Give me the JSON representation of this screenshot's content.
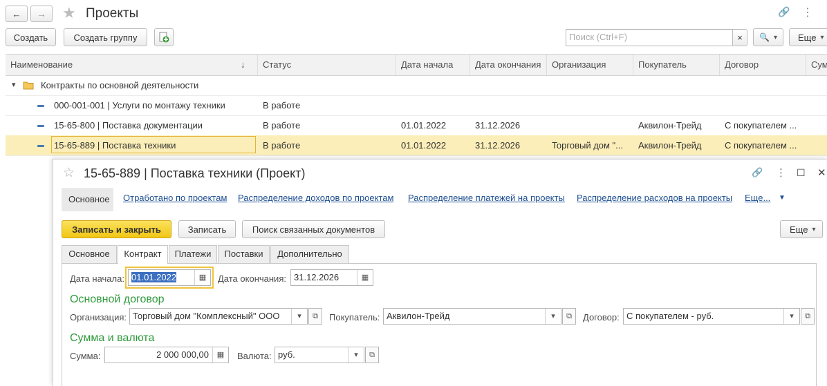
{
  "page": {
    "title": "Проекты",
    "back_icon": "←",
    "forward_icon": "→",
    "star_icon": "★",
    "link_icon": "🔗",
    "more_icon": "⋮"
  },
  "toolbar": {
    "create_label": "Создать",
    "create_group_label": "Создать группу",
    "search_placeholder": "Поиск (Ctrl+F)",
    "clear_icon": "×",
    "search_icon": "🔍",
    "more_label": "Еще"
  },
  "table": {
    "columns": [
      "Наименование",
      "Статус",
      "Дата начала",
      "Дата окончания",
      "Организация",
      "Покупатель",
      "Договор",
      "Сумма"
    ],
    "sort_icon": "↓",
    "group": {
      "expand_icon": "▾",
      "label": "Контракты по основной деятельности"
    },
    "rows": [
      {
        "name": "000-001-001 | Услуги по монтажу техники",
        "status": "В работе",
        "start": "",
        "end": "",
        "org": "",
        "buyer": "",
        "contract": ""
      },
      {
        "name": "15-65-800 | Поставка документации",
        "status": "В работе",
        "start": "01.01.2022",
        "end": "31.12.2026",
        "org": "",
        "buyer": "Аквилон-Трейд",
        "contract": "С покупателем ..."
      },
      {
        "name": "15-65-889 | Поставка техники",
        "status": "В работе",
        "start": "01.01.2022",
        "end": "31.12.2026",
        "org": "Торговый дом \"...",
        "buyer": "Аквилон-Трейд",
        "contract": "С покупателем ..."
      }
    ]
  },
  "dialog": {
    "title": "15-65-889 | Поставка техники (Проект)",
    "star_icon": "☆",
    "link_icon": "🔗",
    "more_icon": "⋮",
    "maximize_icon": "☐",
    "close_icon": "✕",
    "nav": {
      "main_label": "Основное",
      "links": [
        "Отработано по проектам",
        "Распределение доходов по проектам",
        "Распределение платежей на проекты",
        "Распределение расходов на проекты"
      ],
      "more_label": "Еще..."
    },
    "commands": {
      "save_close_label": "Записать и закрыть",
      "save_label": "Записать",
      "find_docs_label": "Поиск связанных документов",
      "more_label": "Еще"
    },
    "tabs": [
      "Основное",
      "Контракт",
      "Платежи",
      "Поставки",
      "Дополнительно"
    ],
    "form": {
      "start_label": "Дата начала:",
      "start_value": "01.01.2022",
      "end_label": "Дата окончания:",
      "end_value": "31.12.2026",
      "calendar_icon": "▦",
      "section_contract": "Основной договор",
      "org_label": "Организация:",
      "org_value": "Торговый дом \"Комплексный\" ООО",
      "buyer_label": "Покупатель:",
      "buyer_value": "Аквилон-Трейд",
      "contract_label": "Договор:",
      "contract_value": "С покупателем - руб.",
      "section_sum": "Сумма и валюта",
      "sum_label": "Сумма:",
      "sum_value": "2 000 000,00",
      "currency_label": "Валюта:",
      "currency_value": "руб.",
      "dropdown_icon": "▾",
      "open_icon": "⧉"
    }
  }
}
